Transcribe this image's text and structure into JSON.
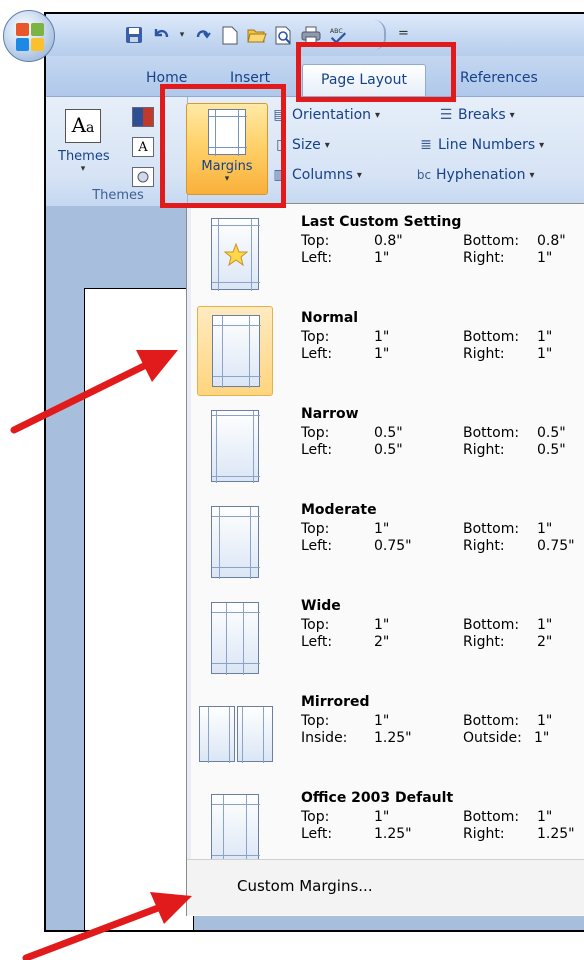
{
  "quick_access": {
    "icons": [
      "save-icon",
      "undo-icon",
      "redo-icon",
      "new-document-icon",
      "open-folder-icon",
      "print-preview-icon",
      "print-icon",
      "spelling-icon"
    ],
    "customize_glyph": "="
  },
  "tabs": [
    {
      "label": "Home",
      "active": false
    },
    {
      "label": "Insert",
      "active": false
    },
    {
      "label": "Page Layout",
      "active": true
    },
    {
      "label": "References",
      "active": false
    }
  ],
  "ribbon": {
    "themes_label": "Themes",
    "themes_group_label": "Themes",
    "margins_label": "Margins",
    "orientation_label": "Orientation",
    "size_label": "Size",
    "columns_label": "Columns",
    "breaks_label": "Breaks",
    "line_numbers_label": "Line Numbers",
    "hyphenation_label": "Hyphenation",
    "dropdown_glyph": "▾"
  },
  "menu": {
    "presets": [
      {
        "name": "Last Custom Setting",
        "k1": "Top:",
        "v1": "0.8\"",
        "k2": "Bottom:",
        "v2": "0.8\"",
        "k3": "Left:",
        "v3": "1\"",
        "k4": "Right:",
        "v4": "1\"",
        "selected": false
      },
      {
        "name": "Normal",
        "k1": "Top:",
        "v1": "1\"",
        "k2": "Bottom:",
        "v2": "1\"",
        "k3": "Left:",
        "v3": "1\"",
        "k4": "Right:",
        "v4": "1\"",
        "selected": true
      },
      {
        "name": "Narrow",
        "k1": "Top:",
        "v1": "0.5\"",
        "k2": "Bottom:",
        "v2": "0.5\"",
        "k3": "Left:",
        "v3": "0.5\"",
        "k4": "Right:",
        "v4": "0.5\"",
        "selected": false
      },
      {
        "name": "Moderate",
        "k1": "Top:",
        "v1": "1\"",
        "k2": "Bottom:",
        "v2": "1\"",
        "k3": "Left:",
        "v3": "0.75\"",
        "k4": "Right:",
        "v4": "0.75\"",
        "selected": false
      },
      {
        "name": "Wide",
        "k1": "Top:",
        "v1": "1\"",
        "k2": "Bottom:",
        "v2": "1\"",
        "k3": "Left:",
        "v3": "2\"",
        "k4": "Right:",
        "v4": "2\"",
        "selected": false
      },
      {
        "name": "Mirrored",
        "k1": "Top:",
        "v1": "1\"",
        "k2": "Bottom:",
        "v2": "1\"",
        "k3": "Inside:",
        "v3": "1.25\"",
        "k4": "Outside:",
        "v4": "1\"",
        "selected": false
      },
      {
        "name": "Office 2003 Default",
        "k1": "Top:",
        "v1": "1\"",
        "k2": "Bottom:",
        "v2": "1\"",
        "k3": "Left:",
        "v3": "1.25\"",
        "k4": "Right:",
        "v4": "1.25\"",
        "selected": false
      }
    ],
    "custom_margins_label": "Custom Margins..."
  },
  "colors": {
    "annotation_red": "#e11b1b",
    "selected_highlight": "#ffd57e",
    "ribbon_text": "#15428b"
  }
}
